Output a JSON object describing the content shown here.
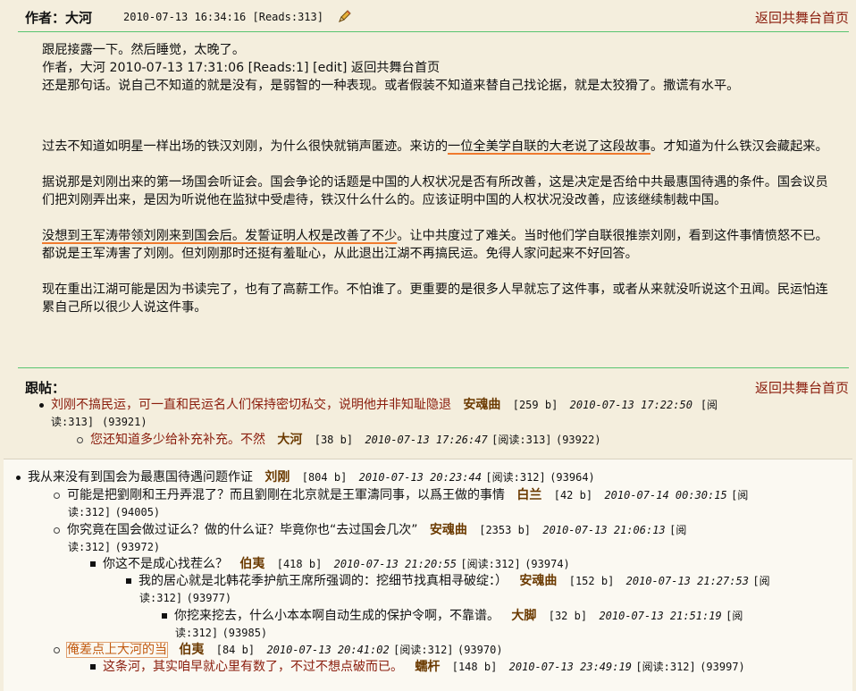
{
  "header": {
    "author_label": "作者：大河",
    "meta": "2010-07-13 16:34:16 [Reads:313]",
    "back_link": "返回共舞台首页"
  },
  "post": {
    "line1": "跟屁接露一下。然后睡觉，太晚了。",
    "line2": "作者，大河 2010-07-13 17:31:06 [Reads:1] [edit] 返回共舞台首页",
    "line3": "还是那句话。说自己不知道的就是没有，是弱智的一种表现。或者假装不知道来替自己找论据，就是太狡猾了。撒谎有水平。",
    "p1_a": "过去不知道如明星一样出场的铁汉刘刚，为什么很快就销声匿迹。来访的",
    "p1_u": "一位全美学自联的大老说了这段故事",
    "p1_b": "。才知道为什么铁汉会藏起来。",
    "p2": "据说那是刘刚出来的第一场国会听证会。国会争论的话题是中国的人权状况是否有所改善，这是决定是否给中共最惠国待遇的条件。国会议员们把刘刚弄出来，是因为听说他在监狱中受虐待，铁汉什么什么的。应该证明中国的人权状况没改善，应该继续制裁中国。",
    "p3_u": "没想到王军涛带领刘刚来到国会后。发誓证明人权是改善了不少",
    "p3_b": "。让中共度过了难关。当时他们学自联很推崇刘刚，看到这件事情愤怒不已。都说是王军涛害了刘刚。但刘刚那时还挺有羞耻心，从此退出江湖不再搞民运。免得人家问起来不好回答。",
    "p4": "现在重出江湖可能是因为书读完了，也有了高薪工作。不怕谁了。更重要的是很多人早就忘了这件事，或者从来就没听说这个丑闻。民运怕连累自己所以很少人说这件事。"
  },
  "replies": {
    "title": "跟帖：",
    "back_link": "返回共舞台首页",
    "r1": {
      "text": "刘刚不搞民运，可一直和民运名人们保持密切私交，说明他并非知耻隐退",
      "author": "安魂曲",
      "size": "[259 b]",
      "date": "2010-07-13 17:22:50",
      "reads_a": "[阅",
      "reads_b": "读:313]",
      "id": "(93921)"
    },
    "r2": {
      "text": "您还知道多少给补充补充。不然",
      "author": "大河",
      "size": "[38 b]",
      "date": "2010-07-13 17:26:47",
      "reads": "[阅读:313]",
      "id": "(93922)"
    }
  },
  "lower": {
    "t1": {
      "text": "我从来没有到国会为最惠国待遇问题作证",
      "author": "刘刚",
      "size": "[804 b]",
      "date": "2010-07-13 20:23:44",
      "reads": "[阅读:312]",
      "id": "(93964)"
    },
    "t2": {
      "text": "可能是把劉剛和王丹弄混了？而且劉剛在北京就是王軍濤同事，以爲王做的事情",
      "author": "白兰",
      "size": "[42 b]",
      "date": "2010-07-14 00:30:15",
      "reads_a": "[阅",
      "reads_b": "读:312]",
      "id": "(94005)"
    },
    "t3": {
      "text": "你究竟在国会做过证么？做的什么证？毕竟你也“去过国会几次”",
      "author": "安魂曲",
      "size": "[2353 b]",
      "date": "2010-07-13 21:06:13",
      "reads_a": "[阅",
      "reads_b": "读:312]",
      "id": "(93972)"
    },
    "t4": {
      "text": "你这不是成心找茬么？",
      "author": "伯夷",
      "size": "[418 b]",
      "date": "2010-07-13 21:20:55",
      "reads": "[阅读:312]",
      "id": "(93974)"
    },
    "t5": {
      "text": "我的居心就是北韩花季护航王席所强调的：挖细节找真相寻破绽：）",
      "author": "安魂曲",
      "size": "[152 b]",
      "date": "2010-07-13 21:27:53",
      "reads_a": "[阅",
      "reads_b": "读:312]",
      "id": "(93977)"
    },
    "t6": {
      "text": "你挖来挖去，什么小本本啊自动生成的保护令啊，不靠谱。",
      "author": "大脚",
      "size": "[32 b]",
      "date": "2010-07-13 21:51:19",
      "reads_a": "[阅",
      "reads_b": "读:312]",
      "id": "(93985)"
    },
    "t7": {
      "text": "俺差点上大河的当",
      "author": "伯夷",
      "size": "[84 b]",
      "date": "2010-07-13 20:41:02",
      "reads": "[阅读:312]",
      "id": "(93970)"
    },
    "t8": {
      "text": "这条河，其实咱早就心里有数了，不过不想点破而已。",
      "author": "蠕杆",
      "size": "[148 b]",
      "date": "2010-07-13 23:49:19",
      "reads": "[阅读:312]",
      "id": "(93997)"
    }
  },
  "colors": {
    "background": "#f4eedd",
    "link": "#8a1c0c",
    "author": "#6b3a00",
    "rule": "#58c470",
    "underline": "#f07a2d"
  },
  "icons": {
    "edit": "pencil-icon"
  }
}
